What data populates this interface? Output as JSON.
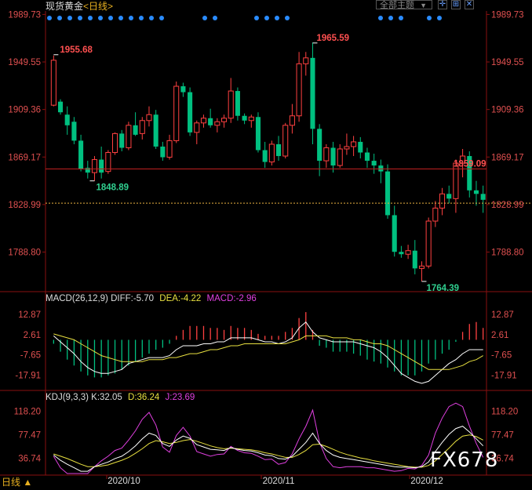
{
  "header": {
    "instrument": "现货黄金",
    "period": "<日线>",
    "theme_button": "全部主题",
    "theme_arrow": "▼"
  },
  "bottom_tab": "日线 ▲",
  "watermark": "FX678",
  "colors": {
    "up": "#ff4040",
    "down": "#00c080",
    "diff": "#ffffff",
    "dea": "#e8e040",
    "macd": "#e040e0"
  },
  "chart_data": [
    {
      "type": "candlestick",
      "ylim": [
        1758,
        1990
      ],
      "y_ticks": [
        "1989.73",
        "1949.55",
        "1909.36",
        "1869.17",
        "1828.99",
        "1788.80"
      ],
      "x_labels": [
        "2020/10",
        "2020/11",
        "2020/12"
      ],
      "annotations": {
        "high_1": "1955.68",
        "high_2": "1965.59",
        "low_1": "1848.89",
        "low_2": "1764.39",
        "last_price": "1859.09"
      },
      "reference_lines": {
        "last": 1859.09,
        "dashed": 1830.2
      },
      "ohlc": [
        [
          1913,
          1955,
          1912,
          1951
        ],
        [
          1916,
          1918,
          1905,
          1907
        ],
        [
          1905,
          1912,
          1888,
          1896
        ],
        [
          1899,
          1903,
          1880,
          1883
        ],
        [
          1883,
          1888,
          1857,
          1859
        ],
        [
          1860,
          1866,
          1851,
          1856
        ],
        [
          1856,
          1870,
          1849,
          1867
        ],
        [
          1867,
          1878,
          1851,
          1856
        ],
        [
          1857,
          1875,
          1855,
          1873
        ],
        [
          1873,
          1890,
          1871,
          1889
        ],
        [
          1889,
          1892,
          1874,
          1877
        ],
        [
          1877,
          1899,
          1875,
          1896
        ],
        [
          1896,
          1907,
          1887,
          1888
        ],
        [
          1889,
          1903,
          1884,
          1900
        ],
        [
          1900,
          1912,
          1895,
          1905
        ],
        [
          1905,
          1909,
          1876,
          1878
        ],
        [
          1878,
          1882,
          1866,
          1869
        ],
        [
          1869,
          1888,
          1867,
          1883
        ],
        [
          1883,
          1933,
          1881,
          1929
        ],
        [
          1929,
          1932,
          1920,
          1924
        ],
        [
          1924,
          1928,
          1887,
          1890
        ],
        [
          1890,
          1900,
          1880,
          1898
        ],
        [
          1898,
          1905,
          1894,
          1902
        ],
        [
          1902,
          1910,
          1894,
          1896
        ],
        [
          1896,
          1902,
          1890,
          1899
        ],
        [
          1899,
          1905,
          1894,
          1902
        ],
        [
          1902,
          1936,
          1898,
          1925
        ],
        [
          1925,
          1928,
          1900,
          1904
        ],
        [
          1904,
          1906,
          1897,
          1900
        ],
        [
          1900,
          1905,
          1894,
          1903
        ],
        [
          1903,
          1907,
          1873,
          1875
        ],
        [
          1875,
          1882,
          1860,
          1865
        ],
        [
          1865,
          1883,
          1862,
          1880
        ],
        [
          1880,
          1887,
          1866,
          1870
        ],
        [
          1870,
          1898,
          1868,
          1896
        ],
        [
          1896,
          1914,
          1889,
          1904
        ],
        [
          1904,
          1958,
          1899,
          1948
        ],
        [
          1948,
          1958,
          1938,
          1953
        ],
        [
          1953,
          1966,
          1880,
          1893
        ],
        [
          1893,
          1897,
          1853,
          1866
        ],
        [
          1866,
          1880,
          1860,
          1877
        ],
        [
          1877,
          1882,
          1856,
          1862
        ],
        [
          1862,
          1880,
          1860,
          1876
        ],
        [
          1876,
          1889,
          1871,
          1878
        ],
        [
          1878,
          1887,
          1870,
          1882
        ],
        [
          1882,
          1886,
          1868,
          1873
        ],
        [
          1873,
          1877,
          1860,
          1866
        ],
        [
          1866,
          1872,
          1855,
          1862
        ],
        [
          1862,
          1867,
          1847,
          1857
        ],
        [
          1857,
          1863,
          1817,
          1820
        ],
        [
          1820,
          1828,
          1785,
          1789
        ],
        [
          1789,
          1794,
          1784,
          1787
        ],
        [
          1787,
          1795,
          1783,
          1790
        ],
        [
          1790,
          1799,
          1770,
          1775
        ],
        [
          1775,
          1781,
          1764,
          1777
        ],
        [
          1777,
          1818,
          1775,
          1815
        ],
        [
          1815,
          1832,
          1810,
          1826
        ],
        [
          1826,
          1843,
          1820,
          1838
        ],
        [
          1838,
          1845,
          1830,
          1834
        ],
        [
          1834,
          1867,
          1822,
          1864
        ],
        [
          1864,
          1876,
          1852,
          1870
        ],
        [
          1870,
          1874,
          1835,
          1841
        ],
        [
          1841,
          1849,
          1828,
          1838
        ],
        [
          1838,
          1845,
          1822,
          1833
        ]
      ]
    },
    {
      "type": "macd",
      "params": "MACD(26,12,9)",
      "diff_label": "DIFF:-5.70",
      "dea_label": "DEA:-4.22",
      "macd_label": "MACD:-2.96",
      "ylim": [
        -24,
        18
      ],
      "y_ticks": [
        "12.87",
        "2.61",
        "-7.65",
        "-17.91"
      ],
      "macd": [
        -2,
        -6,
        -10,
        -13,
        -16,
        -18,
        -19,
        -19,
        -18,
        -17,
        -15,
        -13,
        -11,
        -9,
        -7,
        -5,
        -4,
        -2,
        2,
        5,
        7,
        7,
        7,
        6,
        6,
        5,
        7,
        6,
        6,
        5,
        3,
        2,
        2,
        2,
        4,
        6,
        11,
        14,
        5,
        -3,
        -4,
        -6,
        -6,
        -6,
        -7,
        -8,
        -10,
        -11,
        -12,
        -14,
        -16,
        -18,
        -18,
        -18,
        -16,
        -12,
        -10,
        -7,
        -5,
        -1,
        4,
        8,
        9,
        6
      ],
      "diff": [
        2,
        -1,
        -4,
        -7,
        -11,
        -14,
        -16,
        -17,
        -17,
        -16,
        -15,
        -12,
        -11,
        -10,
        -9,
        -9,
        -9,
        -8,
        -5,
        -3,
        -3,
        -3,
        -2,
        -2,
        -1,
        -1,
        1,
        1,
        1,
        1,
        0,
        -1,
        -1,
        -2,
        -1,
        1,
        6,
        9,
        4,
        1,
        0,
        -1,
        -1,
        -1,
        -1,
        -2,
        -3,
        -4,
        -6,
        -9,
        -13,
        -17,
        -19,
        -21,
        -22,
        -21,
        -18,
        -15,
        -12,
        -10,
        -7,
        -5,
        -5,
        -5
      ],
      "dea": [
        3,
        2,
        1,
        0,
        -2,
        -4,
        -6,
        -8,
        -9,
        -10,
        -11,
        -11,
        -11,
        -11,
        -10,
        -10,
        -10,
        -9,
        -9,
        -8,
        -7,
        -7,
        -6,
        -5,
        -5,
        -4,
        -3,
        -3,
        -2,
        -2,
        -2,
        -2,
        -2,
        -2,
        -2,
        -1,
        0,
        2,
        2,
        2,
        2,
        1,
        1,
        1,
        0,
        0,
        -1,
        -2,
        -2,
        -3,
        -5,
        -7,
        -9,
        -11,
        -13,
        -15,
        -15,
        -15,
        -15,
        -14,
        -13,
        -11,
        -10,
        -8
      ]
    },
    {
      "type": "kdj",
      "params": "KDJ(9,3,3)",
      "k_label": "K:32.05",
      "d_label": "D:36.24",
      "j_label": "J:23.69",
      "ylim": [
        10,
        135
      ],
      "y_ticks": [
        "118.20",
        "77.47",
        "36.74"
      ],
      "k": [
        42,
        33,
        26,
        20,
        14,
        14,
        22,
        26,
        30,
        36,
        40,
        48,
        58,
        70,
        80,
        76,
        62,
        57,
        68,
        75,
        71,
        60,
        56,
        52,
        51,
        50,
        55,
        52,
        50,
        49,
        46,
        42,
        41,
        36,
        35,
        40,
        52,
        64,
        80,
        62,
        50,
        42,
        38,
        36,
        34,
        32,
        30,
        28,
        26,
        24,
        22,
        21,
        21,
        20,
        22,
        30,
        48,
        64,
        78,
        88,
        92,
        82,
        70,
        58
      ],
      "d": [
        44,
        40,
        36,
        31,
        26,
        22,
        22,
        23,
        25,
        29,
        33,
        38,
        45,
        53,
        62,
        67,
        65,
        62,
        64,
        67,
        69,
        66,
        62,
        58,
        55,
        53,
        54,
        53,
        52,
        51,
        49,
        46,
        44,
        41,
        38,
        38,
        43,
        50,
        60,
        61,
        57,
        52,
        47,
        43,
        40,
        37,
        35,
        32,
        30,
        28,
        26,
        24,
        22,
        21,
        21,
        24,
        32,
        43,
        54,
        66,
        75,
        77,
        74,
        68
      ],
      "j": [
        40,
        20,
        8,
        -2,
        -10,
        -2,
        22,
        32,
        40,
        50,
        54,
        68,
        84,
        104,
        116,
        94,
        56,
        47,
        76,
        90,
        75,
        48,
        44,
        40,
        43,
        44,
        57,
        50,
        46,
        45,
        40,
        34,
        35,
        26,
        29,
        44,
        70,
        92,
        120,
        64,
        36,
        22,
        20,
        22,
        22,
        22,
        20,
        20,
        18,
        16,
        14,
        15,
        19,
        18,
        24,
        42,
        80,
        106,
        126,
        132,
        126,
        92,
        62,
        38
      ]
    }
  ]
}
